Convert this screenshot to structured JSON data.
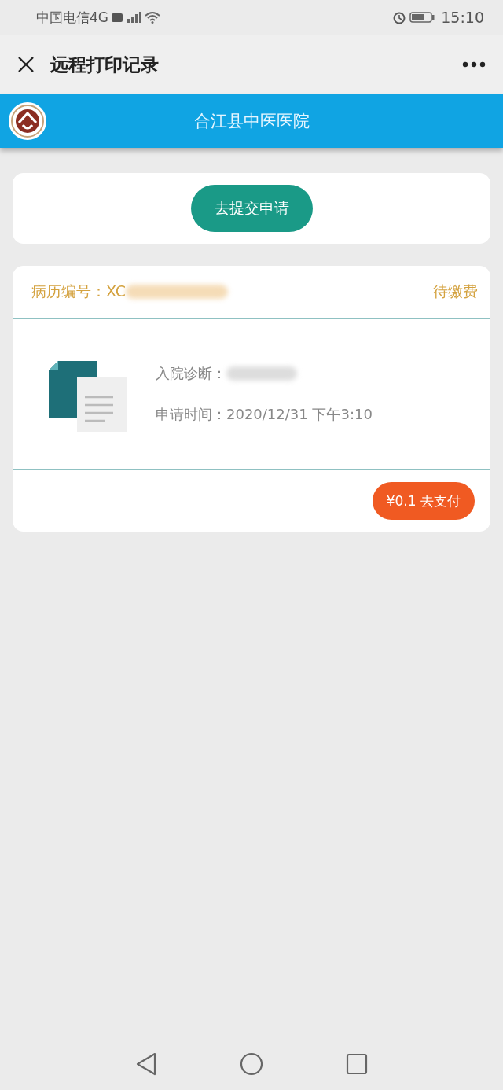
{
  "status_bar": {
    "carrier": "中国电信4G",
    "time": "15:10"
  },
  "nav": {
    "title": "远程打印记录"
  },
  "header": {
    "title": "合江县中医医院"
  },
  "submit_button": {
    "label": "去提交申请"
  },
  "record": {
    "record_no_label": "病历编号：XC",
    "status": "待缴费",
    "diagnosis_label": "入院诊断：",
    "time_label": "申请时间：",
    "time_value": "2020/12/31 下午3:10",
    "pay_button": "¥0.1 去支付"
  }
}
